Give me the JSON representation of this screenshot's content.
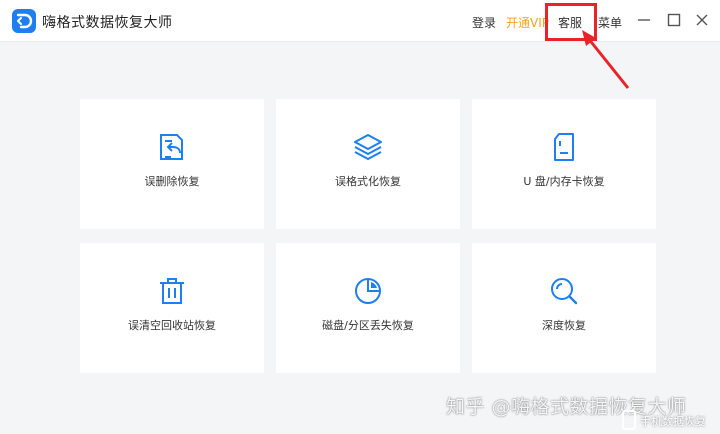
{
  "app": {
    "title": "嗨格式数据恢复大师"
  },
  "titlebar": {
    "login_label": "登录",
    "vip_label": "开通VIP",
    "service_label": "客服",
    "menu_label": "菜单"
  },
  "colors": {
    "brand_blue": "#1e7ff0",
    "vip_orange": "#f0a420",
    "annotation_red": "#e8232a",
    "background": "#f4f5f7"
  },
  "cards": [
    {
      "label": "误删除恢复",
      "icon": "deleted-file-restore-icon"
    },
    {
      "label": "误格式化恢复",
      "icon": "layers-icon"
    },
    {
      "label": "U 盘/内存卡恢复",
      "icon": "sd-card-icon"
    },
    {
      "label": "误清空回收站恢复",
      "icon": "trash-icon"
    },
    {
      "label": "磁盘/分区丢失恢复",
      "icon": "pie-chart-icon"
    },
    {
      "label": "深度恢复",
      "icon": "search-icon"
    }
  ],
  "watermark": {
    "text": "知乎 @嗨格式数据恢复大师",
    "badge_text": "手机数据恢复"
  }
}
